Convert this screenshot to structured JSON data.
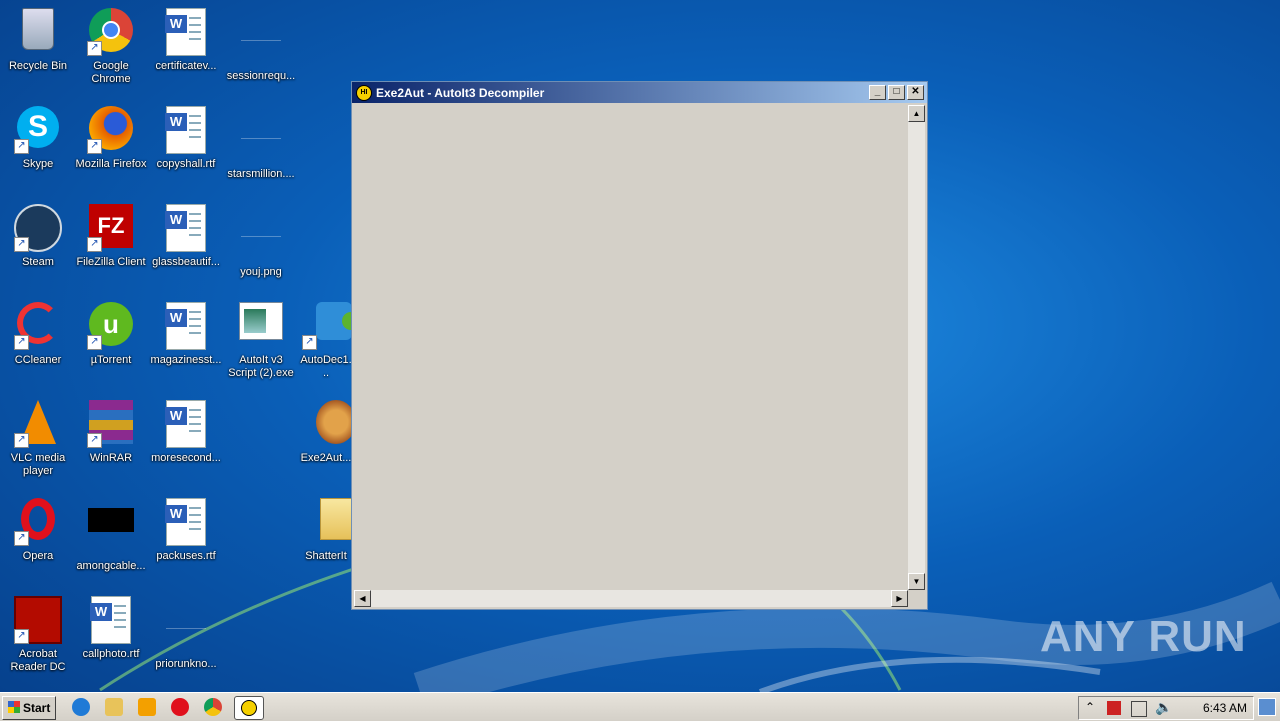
{
  "desktop": {
    "icons": [
      {
        "label": "Recycle Bin"
      },
      {
        "label": "Google Chrome"
      },
      {
        "label": "certificatev..."
      },
      {
        "label": "sessionrequ..."
      },
      {
        "label": "Skype"
      },
      {
        "label": "Mozilla Firefox"
      },
      {
        "label": "copyshall.rtf"
      },
      {
        "label": "starsmillion...."
      },
      {
        "label": "Steam"
      },
      {
        "label": "FileZilla Client"
      },
      {
        "label": "glassbeautif..."
      },
      {
        "label": "youj.png"
      },
      {
        "label": "CCleaner"
      },
      {
        "label": "µTorrent"
      },
      {
        "label": "magazinesst..."
      },
      {
        "label": "AutoIt v3 Script (2).exe"
      },
      {
        "label": "AutoDec1..."
      },
      {
        "label": "VLC media player"
      },
      {
        "label": "WinRAR"
      },
      {
        "label": "moresecond..."
      },
      {
        "label": "Exe2Aut..."
      },
      {
        "label": "Opera"
      },
      {
        "label": "amongcable..."
      },
      {
        "label": "packuses.rtf"
      },
      {
        "label": "ShatterIt"
      },
      {
        "label": "Acrobat Reader DC"
      },
      {
        "label": "callphoto.rtf"
      },
      {
        "label": "priorunkno..."
      }
    ]
  },
  "window": {
    "title": "Exe2Aut - AutoIt3 Decompiler",
    "minimize": "_",
    "maximize": "□",
    "close": "✕"
  },
  "taskbar": {
    "start_label": "Start",
    "clock": "6:43 AM"
  },
  "watermark": "ANY RUN"
}
